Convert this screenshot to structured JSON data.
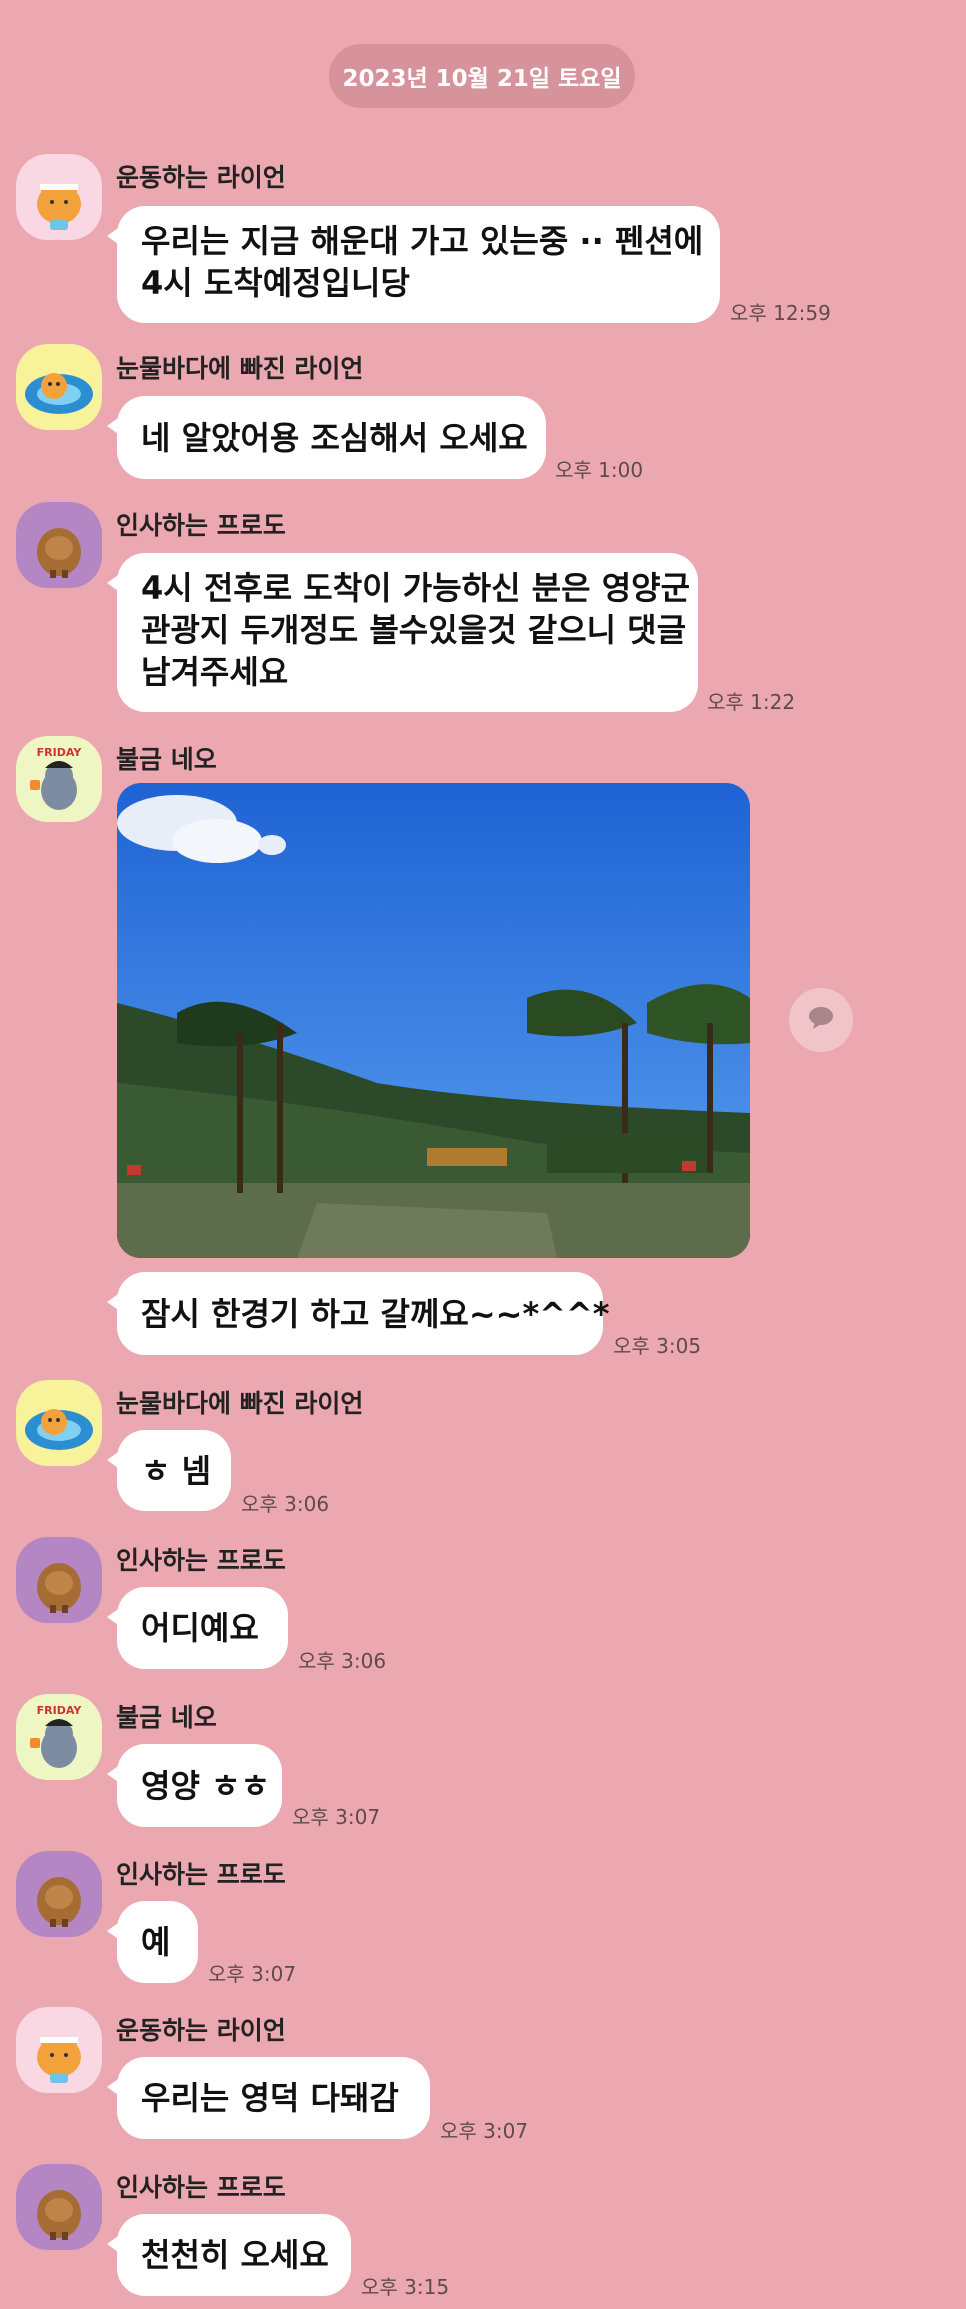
{
  "date_divider": "2023년 10월 21일 토요일",
  "messages": [
    {
      "sender": "운동하는 라이언",
      "avatar_icon": "ryan-exercise-avatar-icon",
      "text_lines": [
        "우리는 지금  해운대 가고 있는중 ·· 펜션에",
        "4시 도착예정입니당"
      ],
      "time": "오후 12:59"
    },
    {
      "sender": "눈물바다에 빠진 라이언",
      "avatar_icon": "ryan-tears-avatar-icon",
      "text_lines": [
        "네 알았어용 조심해서 오세요"
      ],
      "time": "오후 1:00"
    },
    {
      "sender": "인사하는 프로도",
      "avatar_icon": "frodo-bow-avatar-icon",
      "text_lines": [
        "4시 전후로 도착이 가능하신 분은 영양군",
        "관광지 두개정도 볼수있을것 같으니 댓글",
        "남겨주세요"
      ],
      "time": "오후 1:22"
    },
    {
      "sender": "불금 네오",
      "avatar_icon": "neo-friday-avatar-icon",
      "photo": "outdoor-park-photo",
      "text_lines": [
        "잠시 한경기 하고 갈께요~~*^^*"
      ],
      "time": "오후 3:05"
    },
    {
      "sender": "눈물바다에 빠진 라이언",
      "avatar_icon": "ryan-tears-avatar-icon",
      "text_lines": [
        "ㅎ 넴"
      ],
      "time": "오후 3:06"
    },
    {
      "sender": "인사하는 프로도",
      "avatar_icon": "frodo-bow-avatar-icon",
      "text_lines": [
        "어디예요"
      ],
      "time": "오후 3:06"
    },
    {
      "sender": "불금 네오",
      "avatar_icon": "neo-friday-avatar-icon",
      "text_lines": [
        "영양 ㅎㅎ"
      ],
      "time": "오후 3:07"
    },
    {
      "sender": "인사하는 프로도",
      "avatar_icon": "frodo-bow-avatar-icon",
      "text_lines": [
        "예"
      ],
      "time": "오후 3:07"
    },
    {
      "sender": "운동하는 라이언",
      "avatar_icon": "ryan-exercise-avatar-icon",
      "text_lines": [
        "우리는 영덕 다돼감"
      ],
      "time": "오후 3:07"
    },
    {
      "sender": "인사하는 프로도",
      "avatar_icon": "frodo-bow-avatar-icon",
      "text_lines": [
        "천천히 오세요"
      ],
      "time": "오후 3:15"
    }
  ],
  "neo_badge_text": "FRIDAY",
  "share_icon": "speech-bubble-icon",
  "colors": {
    "background": "#eba8b0",
    "date_pill": "#d7939b",
    "bubble": "#ffffff"
  }
}
